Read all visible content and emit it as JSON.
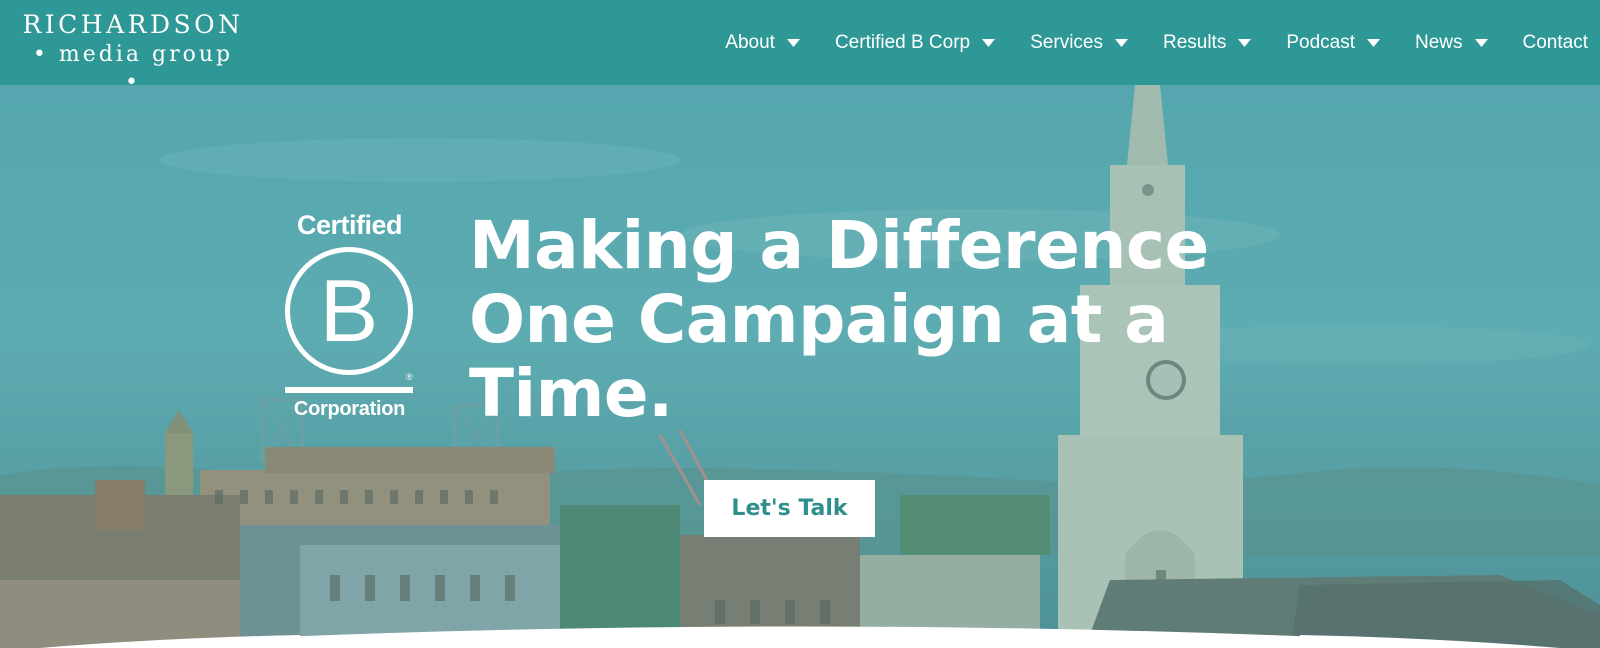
{
  "brand": {
    "name_line1": "RICHARDSON",
    "name_line2": "• media group •"
  },
  "nav": {
    "items": [
      {
        "label": "About",
        "has_dropdown": true
      },
      {
        "label": "Certified B Corp",
        "has_dropdown": true
      },
      {
        "label": "Services",
        "has_dropdown": true
      },
      {
        "label": "Results",
        "has_dropdown": true
      },
      {
        "label": "Podcast",
        "has_dropdown": true
      },
      {
        "label": "News",
        "has_dropdown": true
      },
      {
        "label": "Contact",
        "has_dropdown": false
      }
    ],
    "dropdown_icon": "caret-down-icon"
  },
  "hero": {
    "badge": {
      "top_text": "Certified",
      "letter": "B",
      "registered": "®",
      "bottom_text": "Corporation"
    },
    "headline_lines": [
      "Making a Difference",
      "One Campaign at a",
      "Time."
    ],
    "cta_label": "Let's Talk"
  },
  "colors": {
    "header_bg": "#2e9896",
    "overlay_teal": "#5aa9b1",
    "cta_text": "#2e8f8c",
    "text_light": "#ffffff"
  }
}
